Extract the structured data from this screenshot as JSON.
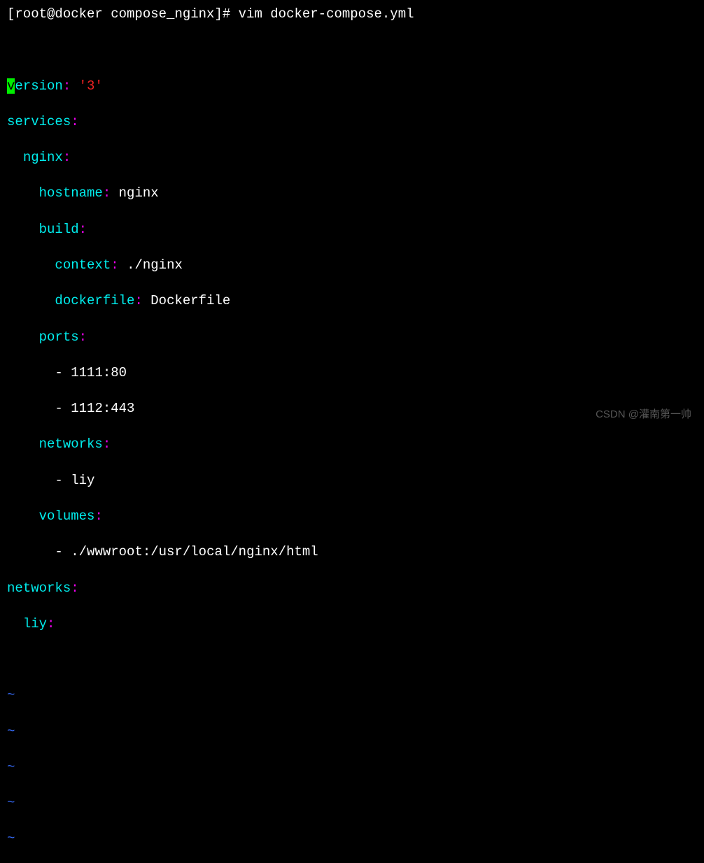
{
  "prompt": {
    "user_host": "[root@docker compose_nginx]# ",
    "command": "vim docker-compose.yml"
  },
  "yaml": {
    "version_key_firstchar": "v",
    "version_key_rest": "ersion",
    "version_value": "'3'",
    "services_key": "services",
    "nginx_key": "nginx",
    "hostname_key": "hostname",
    "hostname_value": "nginx",
    "build_key": "build",
    "context_key": "context",
    "context_value": "./nginx",
    "dockerfile_key": "dockerfile",
    "dockerfile_value": "Dockerfile",
    "ports_key": "ports",
    "port1": "1111:80",
    "port2": "1112:443",
    "networks_key": "networks",
    "network1": "liy",
    "volumes_key": "volumes",
    "volume1": "./wwwroot:/usr/local/nginx/html",
    "top_networks_key": "networks",
    "liy_key": "liy"
  },
  "colon": ":",
  "dash": "- ",
  "indent2": "  ",
  "indent4": "    ",
  "indent6": "      ",
  "indent8": "        ",
  "tilde": "~",
  "watermark": "CSDN @灌南第一帅"
}
